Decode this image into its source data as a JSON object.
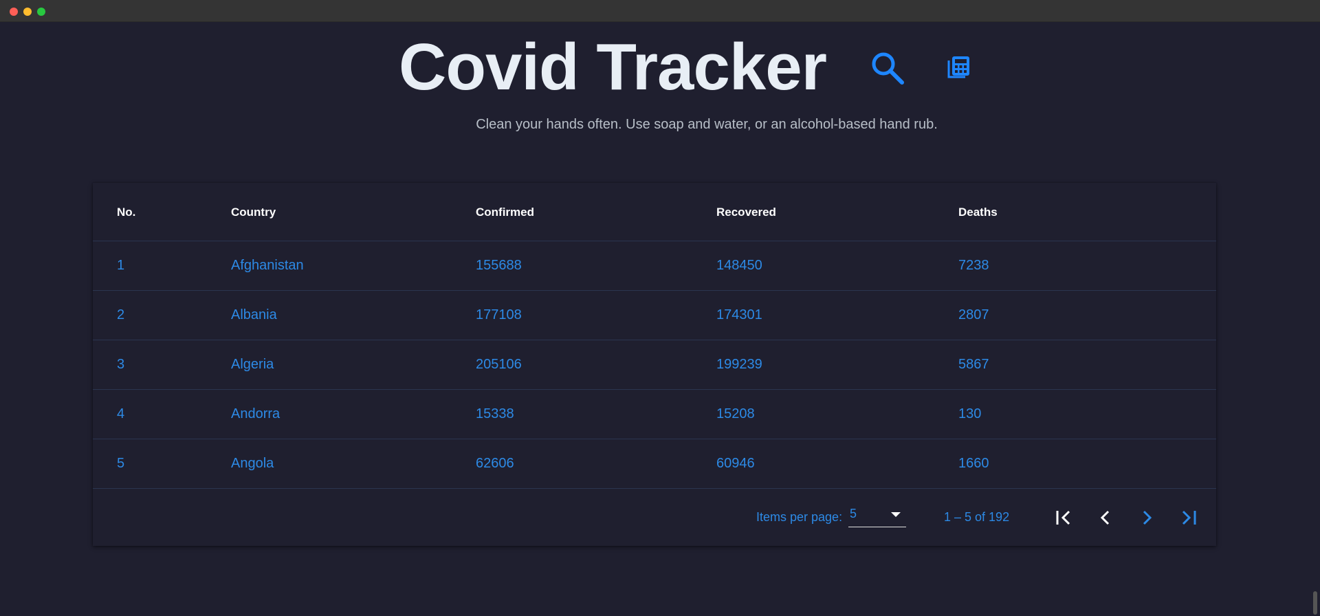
{
  "header": {
    "title": "Covid Tracker",
    "subtitle": "Clean your hands often. Use soap and water, or an alcohol-based hand rub.",
    "search_icon": "search-icon",
    "calculator_icon": "calculator-icon"
  },
  "table": {
    "columns": [
      "No.",
      "Country",
      "Confirmed",
      "Recovered",
      "Deaths"
    ],
    "rows": [
      [
        "1",
        "Afghanistan",
        "155688",
        "148450",
        "7238"
      ],
      [
        "2",
        "Albania",
        "177108",
        "174301",
        "2807"
      ],
      [
        "3",
        "Algeria",
        "205106",
        "199239",
        "5867"
      ],
      [
        "4",
        "Andorra",
        "15338",
        "15208",
        "130"
      ],
      [
        "5",
        "Angola",
        "62606",
        "60946",
        "1660"
      ]
    ]
  },
  "paginator": {
    "items_per_page_label": "Items per page:",
    "items_per_page_value": "5",
    "range_label": "1 – 5 of 192"
  },
  "colors": {
    "background": "#1f1f2f",
    "accent": "#2d8ae6",
    "divider": "#2b3550",
    "title": "#e8eef5"
  }
}
